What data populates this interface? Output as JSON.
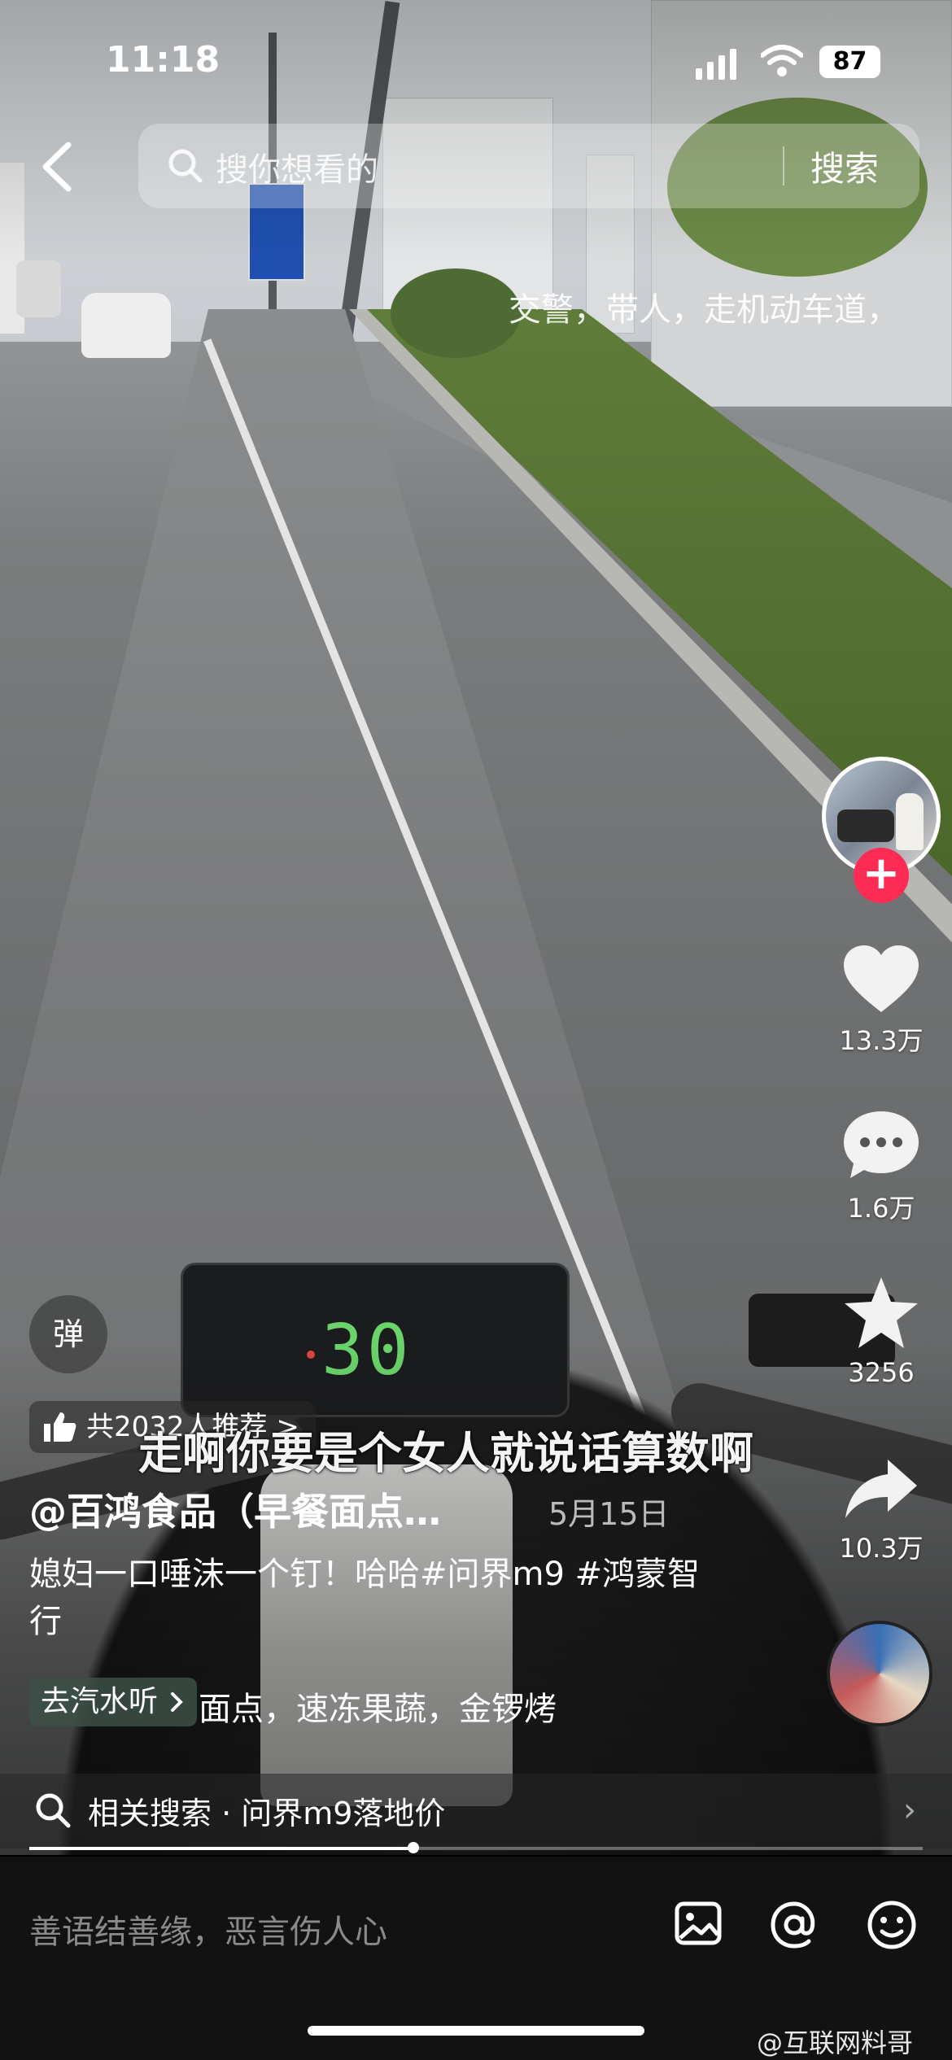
{
  "status_bar": {
    "time": "11:18",
    "battery": "87"
  },
  "search": {
    "placeholder": "搜你想看的",
    "button": "搜索"
  },
  "overlay_caption": "交警，带人，走机动车道，",
  "speedometer": {
    "reading": "30"
  },
  "actions": {
    "likes": "13.3万",
    "comments": "1.6万",
    "favorites": "3256",
    "shares": "10.3万"
  },
  "danmu_label": "弹",
  "recommend_text": "共2032人推荐 >",
  "video_subtitle": "走啊你要是个女人就说话算数啊",
  "author": "@百鸿食品（早餐面点…",
  "post_date": "5月15日",
  "description": "媳妇一口唾沫一个钉！哈哈#问界m9 #鸿蒙智行",
  "store_link": {
    "label": "去汽水听",
    "trailing": "面点，速冻果蔬，金锣烤"
  },
  "related_search": "相关搜索 · 问界m9落地价",
  "playback_progress": 0.43,
  "comment_placeholder": "善语结善缘，恶言伤人心",
  "watermark": "@互联网料哥",
  "colors": {
    "follow": "#fe2c55",
    "speed_digits": "#6ad36a",
    "comment_bar": "#121212"
  }
}
